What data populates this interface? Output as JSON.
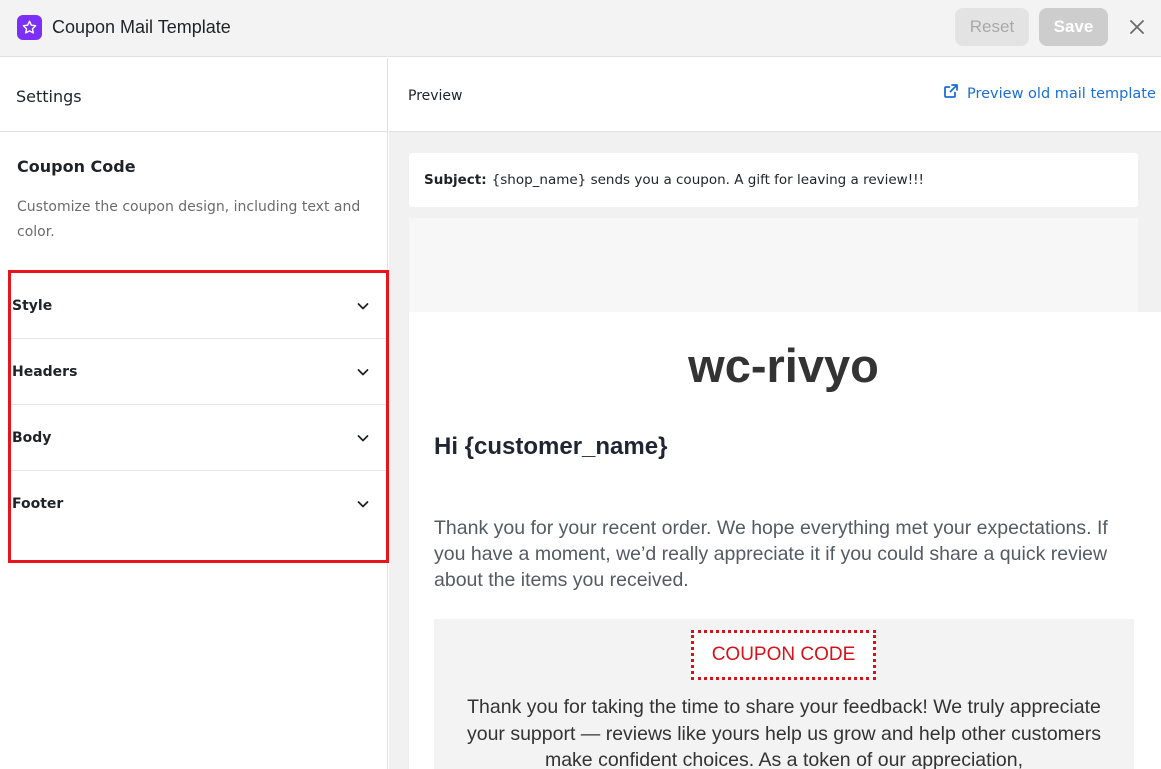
{
  "app": {
    "title": "Coupon Mail Template",
    "logo_icon": "star-logo-icon",
    "brand_color": "#7b2ff7"
  },
  "toolbar": {
    "reset_label": "Reset",
    "save_label": "Save",
    "close_icon": "close-icon"
  },
  "settings": {
    "title": "Settings",
    "section_title": "Coupon Code",
    "section_description": "Customize the coupon design, including text and color.",
    "highlight_color": "#e8141c",
    "items": [
      {
        "label": "Style"
      },
      {
        "label": "Headers"
      },
      {
        "label": "Body"
      },
      {
        "label": "Footer"
      }
    ]
  },
  "preview": {
    "title": "Preview",
    "old_link_label": "Preview old mail template",
    "link_color": "#1a6fd6",
    "subject_label": "Subject:",
    "subject_text": "{shop_name} sends you a coupon. A gift for leaving a review!!!"
  },
  "email": {
    "shop_name": "wc-rivyo",
    "greeting": "Hi {customer_name}",
    "intro": "Thank you for your recent order. We hope everything met your expectations. If you have a moment, we’d really appreciate it if you could share a quick review about the items you received.",
    "coupon_code": "COUPON CODE",
    "coupon_color": "#d4141a",
    "coupon_text": "Thank you for taking the time to share your feedback! We truly appreciate your support — reviews like yours help us grow and help other customers make confident choices. As a token of our appreciation,"
  }
}
